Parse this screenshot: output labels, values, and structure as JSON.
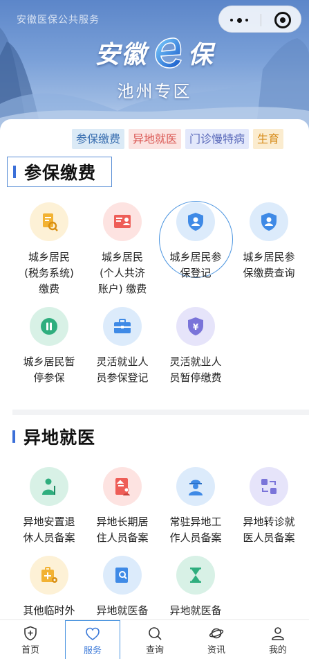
{
  "header": {
    "app_name": "安徽医保公共服务",
    "logo_left": "安徽",
    "logo_right": "保",
    "region": "池州专区",
    "capsule": {
      "more_icon": "more-dots-icon",
      "close_icon": "target-icon"
    }
  },
  "quick_tabs": [
    "参保缴费",
    "异地就医",
    "门诊慢特病",
    "生育"
  ],
  "sections": {
    "insurance": {
      "title": "参保缴费",
      "items": [
        {
          "label": "城乡居民\n(税务系统)\n缴费",
          "icon": "document-search-icon",
          "color": "#f2b233"
        },
        {
          "label": "城乡居民\n(个人共济\n账户) 缴费",
          "icon": "book-card-icon",
          "color": "#ee5d57"
        },
        {
          "label": "城乡居民参\n保登记",
          "icon": "shield-user-icon",
          "color": "#3f8ae6"
        },
        {
          "label": "城乡居民参\n保缴费查询",
          "icon": "shield-user-icon",
          "color": "#3f8ae6"
        },
        {
          "label": "城乡居民暂\n停参保",
          "icon": "pause-icon",
          "color": "#2fae7e"
        },
        {
          "label": "灵活就业人\n员参保登记",
          "icon": "briefcase-icon",
          "color": "#3f8ae6"
        },
        {
          "label": "灵活就业人\n员暂停缴费",
          "icon": "yuan-shield-icon",
          "color": "#7a74d9"
        }
      ]
    },
    "remote": {
      "title": "异地就医",
      "items": [
        {
          "label": "异地安置退\n休人员备案",
          "icon": "retiree-icon",
          "color": "#2fae7e"
        },
        {
          "label": "异地长期居\n住人员备案",
          "icon": "residence-card-icon",
          "color": "#ee5d57"
        },
        {
          "label": "常驻异地工\n作人员备案",
          "icon": "worker-icon",
          "color": "#3f8ae6"
        },
        {
          "label": "异地转诊就\n医人员备案",
          "icon": "transfer-icon",
          "color": "#7a74d9"
        },
        {
          "label": "其他临时外",
          "icon": "medical-kit-location-icon",
          "color": "#f2b233"
        },
        {
          "label": "异地就医备",
          "icon": "search-card-icon",
          "color": "#3f8ae6"
        },
        {
          "label": "异地就医备",
          "icon": "hourglass-icon",
          "color": "#2fae7e"
        }
      ]
    }
  },
  "tabbar": {
    "items": [
      {
        "label": "首页",
        "icon": "home-shield-icon"
      },
      {
        "label": "服务",
        "icon": "heart-icon"
      },
      {
        "label": "查询",
        "icon": "search-icon"
      },
      {
        "label": "资讯",
        "icon": "planet-icon"
      },
      {
        "label": "我的",
        "icon": "user-icon"
      }
    ],
    "active": "服务"
  }
}
